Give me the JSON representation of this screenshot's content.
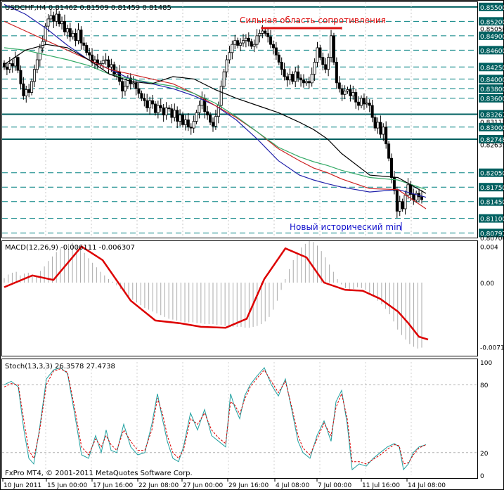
{
  "colors": {
    "background": "#ffffff",
    "frame": "#000000",
    "grid_solid": "#006060",
    "grid_dash": "#008080",
    "candle": "#000000",
    "ma_blue": "#2222aa",
    "ma_red": "#cc2222",
    "ma_green": "#33aa66",
    "ma_black": "#000000",
    "price_label_bg": "#006060",
    "annotation_red": "#dd1111",
    "annotation_blue": "#1111cc",
    "macd_line": "#dd0000",
    "macd_hist": "#aaaaaa",
    "stoch_main": "#20a0a0",
    "stoch_signal": "#dd0000"
  },
  "header": {
    "symbol_info": "USDCHF,H4  0.81462 0.81509 0.81459 0.81485"
  },
  "annotations": {
    "resistance_label": "Сильная область сопротивления",
    "new_min_label": "Новый исторический min"
  },
  "footer": {
    "copyright": "FxPro MT4, © 2001-2011 MetaQuotes Software Corp."
  },
  "chart_data": [
    {
      "type": "line",
      "title": "USDCHF,H4",
      "subtitle": "0.81462 0.81509 0.81459 0.81485",
      "ylim": [
        0.807,
        0.856
      ],
      "price_axis_ticks": [
        "0.85500",
        "0.85200",
        "0.85050",
        "0.84900",
        "0.84600",
        "0.84250",
        "0.84000",
        "0.83800",
        "0.83600",
        "0.83267",
        "0.83115",
        "0.83000",
        "0.82748",
        "0.82635",
        "0.82050",
        "0.81750",
        "0.81450",
        "0.81100",
        "0.80797",
        "0.80700"
      ],
      "price_axis_highlighted": [
        "0.85500",
        "0.85200",
        "0.84900",
        "0.84600",
        "0.84250",
        "0.84000",
        "0.83800",
        "0.83600",
        "0.83267",
        "0.83000",
        "0.82748",
        "0.82050",
        "0.81750",
        "0.81450",
        "0.81100",
        "0.80797"
      ],
      "levels_solid": [
        0.855,
        0.83267,
        0.82748
      ],
      "levels_dashed": [
        0.852,
        0.849,
        0.846,
        0.8425,
        0.84,
        0.838,
        0.836,
        0.83,
        0.8205,
        0.8175,
        0.8145,
        0.811,
        0.80797
      ],
      "x_labels": [
        "10 Jun 2011",
        "15 Jun 00:00",
        "17 Jun 16:00",
        "22 Jun 08:00",
        "27 Jun 00:00",
        "29 Jun 16:00",
        "4 Jul 08:00",
        "7 Jul 00:00",
        "11 Jul 16:00",
        "14 Jul 08:00"
      ],
      "close": [
        0.8425,
        0.842,
        0.8432,
        0.8427,
        0.8445,
        0.8418,
        0.839,
        0.8365,
        0.8378,
        0.8372,
        0.8395,
        0.842,
        0.844,
        0.8465,
        0.8478,
        0.851,
        0.8525,
        0.8532,
        0.852,
        0.8535,
        0.8515,
        0.852,
        0.8498,
        0.8505,
        0.8488,
        0.8495,
        0.848,
        0.8502,
        0.8475,
        0.847,
        0.8455,
        0.845,
        0.8435,
        0.844,
        0.843,
        0.8432,
        0.8438,
        0.844,
        0.8425,
        0.843,
        0.841,
        0.8415,
        0.8395,
        0.8375,
        0.8385,
        0.8402,
        0.839,
        0.8392,
        0.838,
        0.837,
        0.836,
        0.8355,
        0.834,
        0.8355,
        0.8348,
        0.833,
        0.8345,
        0.834,
        0.8325,
        0.834,
        0.8338,
        0.832,
        0.8335,
        0.8312,
        0.8325,
        0.8305,
        0.8315,
        0.83,
        0.8298,
        0.8312,
        0.833,
        0.8345,
        0.836,
        0.8332,
        0.8325,
        0.831,
        0.8302,
        0.8322,
        0.8345,
        0.8385,
        0.8415,
        0.844,
        0.8455,
        0.8472,
        0.848,
        0.847,
        0.8475,
        0.848,
        0.8485,
        0.8478,
        0.8468,
        0.8472,
        0.849,
        0.8495,
        0.85,
        0.8495,
        0.8488,
        0.8472,
        0.8465,
        0.845,
        0.8435,
        0.842,
        0.8405,
        0.8398,
        0.841,
        0.8395,
        0.8415,
        0.8402,
        0.8398,
        0.8392,
        0.8395,
        0.8392,
        0.841,
        0.8435,
        0.8465,
        0.8445,
        0.843,
        0.842,
        0.8445,
        0.849,
        0.8435,
        0.8392,
        0.838,
        0.8368,
        0.8375,
        0.8378,
        0.8365,
        0.8372,
        0.8352,
        0.8345,
        0.836,
        0.8348,
        0.835,
        0.8345,
        0.832,
        0.8298,
        0.831,
        0.8285,
        0.83,
        0.8265,
        0.8235,
        0.8195,
        0.8168,
        0.8125,
        0.8145,
        0.813,
        0.8158,
        0.818,
        0.816,
        0.8148,
        0.8162,
        0.8155,
        0.8149
      ],
      "ma_blue": [
        [
          0,
          0.8555
        ],
        [
          30,
          0.8535
        ],
        [
          60,
          0.8505
        ],
        [
          90,
          0.847
        ],
        [
          120,
          0.844
        ],
        [
          150,
          0.842
        ],
        [
          180,
          0.84
        ],
        [
          210,
          0.839
        ],
        [
          240,
          0.838
        ],
        [
          270,
          0.8365
        ],
        [
          300,
          0.8345
        ],
        [
          330,
          0.8315
        ],
        [
          360,
          0.8275
        ],
        [
          390,
          0.823
        ],
        [
          420,
          0.82
        ],
        [
          440,
          0.819
        ],
        [
          460,
          0.8182
        ],
        [
          480,
          0.8175
        ],
        [
          520,
          0.8165
        ],
        [
          560,
          0.817
        ],
        [
          600,
          0.8154
        ]
      ],
      "ma_red": [
        [
          0,
          0.852
        ],
        [
          30,
          0.85
        ],
        [
          60,
          0.848
        ],
        [
          90,
          0.846
        ],
        [
          120,
          0.844
        ],
        [
          150,
          0.842
        ],
        [
          180,
          0.841
        ],
        [
          210,
          0.84
        ],
        [
          240,
          0.839
        ],
        [
          270,
          0.837
        ],
        [
          300,
          0.8345
        ],
        [
          330,
          0.832
        ],
        [
          360,
          0.829
        ],
        [
          390,
          0.8255
        ],
        [
          420,
          0.823
        ],
        [
          440,
          0.8215
        ],
        [
          460,
          0.8205
        ],
        [
          480,
          0.8192
        ],
        [
          520,
          0.8172
        ],
        [
          560,
          0.817
        ],
        [
          600,
          0.813
        ]
      ],
      "ma_green": [
        [
          0,
          0.8465
        ],
        [
          30,
          0.846
        ],
        [
          60,
          0.845
        ],
        [
          90,
          0.844
        ],
        [
          120,
          0.8428
        ],
        [
          150,
          0.841
        ],
        [
          180,
          0.84
        ],
        [
          210,
          0.8392
        ],
        [
          240,
          0.8385
        ],
        [
          270,
          0.837
        ],
        [
          300,
          0.835
        ],
        [
          330,
          0.8322
        ],
        [
          360,
          0.829
        ],
        [
          390,
          0.8258
        ],
        [
          420,
          0.8238
        ],
        [
          440,
          0.8228
        ],
        [
          460,
          0.822
        ],
        [
          480,
          0.821
        ],
        [
          520,
          0.8195
        ],
        [
          560,
          0.819
        ],
        [
          600,
          0.817
        ]
      ],
      "ma_black": [
        [
          0,
          0.843
        ],
        [
          30,
          0.846
        ],
        [
          60,
          0.8472
        ],
        [
          90,
          0.8465
        ],
        [
          120,
          0.844
        ],
        [
          150,
          0.841
        ],
        [
          180,
          0.8395
        ],
        [
          210,
          0.839
        ],
        [
          240,
          0.8405
        ],
        [
          270,
          0.84
        ],
        [
          300,
          0.8378
        ],
        [
          330,
          0.836
        ],
        [
          360,
          0.8345
        ],
        [
          390,
          0.833
        ],
        [
          420,
          0.831
        ],
        [
          440,
          0.8295
        ],
        [
          460,
          0.8275
        ],
        [
          480,
          0.8245
        ],
        [
          520,
          0.82
        ],
        [
          560,
          0.8195
        ],
        [
          600,
          0.8162
        ]
      ]
    },
    {
      "type": "area",
      "title": "MACD(12,26,9)",
      "subtitle": "-0.006111 -0.006307",
      "ylim": [
        -0.0081,
        0.0046
      ],
      "axis_ticks": [
        "0.004",
        "0.00",
        "-0.00714"
      ],
      "axis_tick_values": [
        0.004,
        0.0,
        -0.00714
      ],
      "signal": [
        [
          0,
          -0.0005
        ],
        [
          40,
          0.0008
        ],
        [
          70,
          0.0003
        ],
        [
          110,
          0.004
        ],
        [
          140,
          0.0025
        ],
        [
          180,
          -0.002
        ],
        [
          215,
          -0.0042
        ],
        [
          250,
          -0.0045
        ],
        [
          280,
          -0.0049
        ],
        [
          315,
          -0.005
        ],
        [
          345,
          -0.004
        ],
        [
          370,
          0.0004
        ],
        [
          400,
          0.0038
        ],
        [
          430,
          0.0028
        ],
        [
          455,
          0.0
        ],
        [
          485,
          -0.0008
        ],
        [
          510,
          -0.0009
        ],
        [
          535,
          -0.0018
        ],
        [
          560,
          -0.0032
        ],
        [
          575,
          -0.0045
        ],
        [
          590,
          -0.006
        ],
        [
          603,
          -0.0063
        ]
      ],
      "histogram": [
        0.0005,
        0.0009,
        0.0011,
        0.0012,
        0.0008,
        0.001,
        0.0011,
        0.0009,
        0.0008,
        0.0013,
        0.0018,
        0.0024,
        0.0029,
        0.0034,
        0.0038,
        0.0042,
        0.0043,
        0.0044,
        0.0042,
        0.0038,
        0.0033,
        0.0027,
        0.0022,
        0.0017,
        0.0012,
        0.0008,
        0.0004,
        0.0001,
        -0.0003,
        -0.0007,
        -0.0011,
        -0.0015,
        -0.0019,
        -0.0022,
        -0.0025,
        -0.0028,
        -0.003,
        -0.0032,
        -0.0034,
        -0.0036,
        -0.0038,
        -0.004,
        -0.0041,
        -0.0042,
        -0.0043,
        -0.0044,
        -0.0044,
        -0.0044,
        -0.0045,
        -0.0045,
        -0.0046,
        -0.0046,
        -0.0046,
        -0.0047,
        -0.0047,
        -0.0048,
        -0.0048,
        -0.0049,
        -0.0049,
        -0.0049,
        -0.005,
        -0.005,
        -0.0049,
        -0.0048,
        -0.0046,
        -0.0043,
        -0.0038,
        -0.003,
        -0.002,
        -0.0008,
        0.0004,
        0.0015,
        0.0025,
        0.0033,
        0.0039,
        0.0043,
        0.0046,
        0.0045,
        0.0041,
        0.0035,
        0.0028,
        0.002,
        0.0012,
        0.0004,
        -0.0002,
        -0.0006,
        -0.0008,
        -0.0007,
        -0.0005,
        -0.0006,
        -0.0008,
        -0.0011,
        -0.0015,
        -0.002,
        -0.0024,
        -0.0029,
        -0.0035,
        -0.0043,
        -0.0052,
        -0.0058,
        -0.0063,
        -0.0068,
        -0.0071,
        -0.0073,
        -0.0072
      ]
    },
    {
      "type": "line",
      "title": "Stoch(13,3,3)",
      "subtitle": "26.3578 27.4738",
      "ylim": [
        0,
        100
      ],
      "axis_ticks": [
        "100",
        "80",
        "20",
        "0"
      ],
      "axis_tick_values": [
        100,
        80,
        20,
        0
      ],
      "main": [
        [
          0,
          80
        ],
        [
          10,
          83
        ],
        [
          20,
          78
        ],
        [
          28,
          40
        ],
        [
          35,
          15
        ],
        [
          42,
          10
        ],
        [
          50,
          40
        ],
        [
          60,
          85
        ],
        [
          70,
          93
        ],
        [
          80,
          95
        ],
        [
          90,
          90
        ],
        [
          100,
          55
        ],
        [
          110,
          18
        ],
        [
          120,
          15
        ],
        [
          130,
          35
        ],
        [
          138,
          20
        ],
        [
          145,
          40
        ],
        [
          152,
          22
        ],
        [
          160,
          20
        ],
        [
          170,
          45
        ],
        [
          180,
          25
        ],
        [
          190,
          18
        ],
        [
          200,
          20
        ],
        [
          210,
          45
        ],
        [
          218,
          72
        ],
        [
          225,
          50
        ],
        [
          232,
          30
        ],
        [
          240,
          15
        ],
        [
          248,
          12
        ],
        [
          255,
          25
        ],
        [
          265,
          55
        ],
        [
          275,
          40
        ],
        [
          285,
          58
        ],
        [
          295,
          35
        ],
        [
          305,
          30
        ],
        [
          315,
          25
        ],
        [
          322,
          72
        ],
        [
          328,
          60
        ],
        [
          335,
          50
        ],
        [
          342,
          70
        ],
        [
          350,
          80
        ],
        [
          360,
          88
        ],
        [
          370,
          95
        ],
        [
          380,
          80
        ],
        [
          390,
          70
        ],
        [
          400,
          85
        ],
        [
          410,
          55
        ],
        [
          418,
          30
        ],
        [
          425,
          20
        ],
        [
          435,
          15
        ],
        [
          445,
          35
        ],
        [
          455,
          48
        ],
        [
          465,
          30
        ],
        [
          472,
          65
        ],
        [
          480,
          75
        ],
        [
          488,
          45
        ],
        [
          495,
          5
        ],
        [
          505,
          10
        ],
        [
          515,
          8
        ],
        [
          525,
          15
        ],
        [
          535,
          20
        ],
        [
          545,
          25
        ],
        [
          555,
          28
        ],
        [
          562,
          25
        ],
        [
          568,
          5
        ],
        [
          575,
          10
        ],
        [
          582,
          20
        ],
        [
          590,
          25
        ],
        [
          600,
          27
        ]
      ],
      "signal": [
        [
          0,
          78
        ],
        [
          10,
          81
        ],
        [
          20,
          80
        ],
        [
          28,
          48
        ],
        [
          35,
          22
        ],
        [
          42,
          15
        ],
        [
          50,
          38
        ],
        [
          60,
          80
        ],
        [
          70,
          92
        ],
        [
          80,
          94
        ],
        [
          90,
          91
        ],
        [
          100,
          60
        ],
        [
          110,
          25
        ],
        [
          120,
          18
        ],
        [
          130,
          32
        ],
        [
          138,
          25
        ],
        [
          145,
          35
        ],
        [
          152,
          27
        ],
        [
          160,
          22
        ],
        [
          170,
          40
        ],
        [
          180,
          30
        ],
        [
          190,
          22
        ],
        [
          200,
          22
        ],
        [
          210,
          40
        ],
        [
          218,
          68
        ],
        [
          225,
          55
        ],
        [
          232,
          35
        ],
        [
          240,
          20
        ],
        [
          248,
          15
        ],
        [
          255,
          22
        ],
        [
          265,
          50
        ],
        [
          275,
          45
        ],
        [
          285,
          55
        ],
        [
          295,
          40
        ],
        [
          305,
          33
        ],
        [
          315,
          28
        ],
        [
          322,
          65
        ],
        [
          328,
          62
        ],
        [
          335,
          54
        ],
        [
          342,
          67
        ],
        [
          350,
          78
        ],
        [
          360,
          86
        ],
        [
          370,
          93
        ],
        [
          380,
          83
        ],
        [
          390,
          73
        ],
        [
          400,
          83
        ],
        [
          410,
          58
        ],
        [
          418,
          35
        ],
        [
          425,
          24
        ],
        [
          435,
          18
        ],
        [
          445,
          32
        ],
        [
          455,
          46
        ],
        [
          465,
          35
        ],
        [
          472,
          60
        ],
        [
          480,
          72
        ],
        [
          488,
          50
        ],
        [
          495,
          12
        ],
        [
          505,
          12
        ],
        [
          515,
          10
        ],
        [
          525,
          14
        ],
        [
          535,
          18
        ],
        [
          545,
          23
        ],
        [
          555,
          27
        ],
        [
          562,
          26
        ],
        [
          568,
          10
        ],
        [
          575,
          11
        ],
        [
          582,
          18
        ],
        [
          590,
          24
        ],
        [
          600,
          27
        ]
      ]
    }
  ]
}
